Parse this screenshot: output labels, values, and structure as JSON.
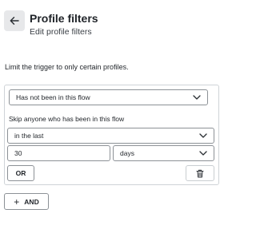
{
  "header": {
    "back_icon": "arrow-left-icon",
    "title": "Profile filters",
    "subtitle": "Edit profile filters"
  },
  "description": "Limit the trigger to only certain profiles.",
  "filter": {
    "condition_select": {
      "value": "Has not been in this flow",
      "icon": "chevron-down-icon"
    },
    "skip_label": "Skip anyone who has been in this flow",
    "timeframe_select": {
      "value": "in the last",
      "icon": "chevron-down-icon"
    },
    "amount_input": {
      "value": "30"
    },
    "unit_select": {
      "value": "days",
      "icon": "chevron-down-icon"
    },
    "or_button": "OR",
    "delete_icon": "trash-icon"
  },
  "and_button": "AND"
}
